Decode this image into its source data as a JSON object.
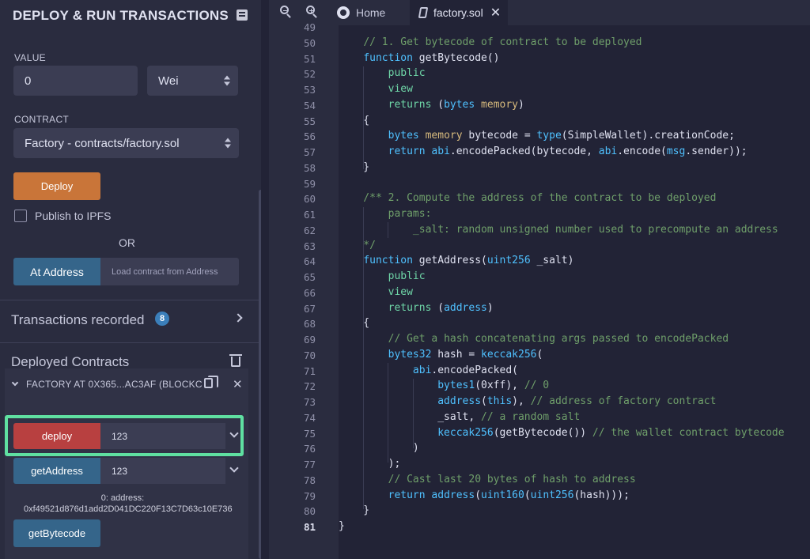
{
  "left_panel": {
    "title": "DEPLOY & RUN TRANSACTIONS",
    "value_label": "VALUE",
    "value_input": "0",
    "unit_select": "Wei",
    "contract_label": "CONTRACT",
    "contract_select": "Factory - contracts/factory.sol",
    "deploy_button": "Deploy",
    "publish_ipfs_label": "Publish to IPFS",
    "or_text": "OR",
    "at_address_button": "At Address",
    "load_contract_placeholder": "Load contract from Address",
    "transactions_recorded_label": "Transactions recorded",
    "transactions_count": "8",
    "deployed_contracts_label": "Deployed Contracts",
    "deployed_instance": {
      "header": "FACTORY AT 0X365...AC3AF (BLOCKC",
      "functions": [
        {
          "label": "deploy",
          "arg_value": "123"
        },
        {
          "label": "getAddress",
          "arg_value": "123"
        },
        {
          "label": "getBytecode"
        }
      ],
      "output": "0: address: 0xf49521d876d1add2D041DC220F13C7D63c10E736"
    }
  },
  "editor": {
    "tabs": [
      {
        "label": "Home"
      },
      {
        "label": "factory.sol",
        "active": true
      }
    ],
    "active_line": "81",
    "lines": [
      {
        "no": "49",
        "text": ""
      },
      {
        "no": "50",
        "text": "    // 1. Get bytecode of contract to be deployed"
      },
      {
        "no": "51",
        "text": "    function getBytecode()"
      },
      {
        "no": "52",
        "text": "        public"
      },
      {
        "no": "53",
        "text": "        view"
      },
      {
        "no": "54",
        "text": "        returns (bytes memory)"
      },
      {
        "no": "55",
        "text": "    {"
      },
      {
        "no": "56",
        "text": "        bytes memory bytecode = type(SimpleWallet).creationCode;"
      },
      {
        "no": "57",
        "text": "        return abi.encodePacked(bytecode, abi.encode(msg.sender));"
      },
      {
        "no": "58",
        "text": "    }"
      },
      {
        "no": "59",
        "text": ""
      },
      {
        "no": "60",
        "text": "    /** 2. Compute the address of the contract to be deployed"
      },
      {
        "no": "61",
        "text": "        params:"
      },
      {
        "no": "62",
        "text": "            _salt: random unsigned number used to precompute an address"
      },
      {
        "no": "63",
        "text": "    */"
      },
      {
        "no": "64",
        "text": "    function getAddress(uint256 _salt)"
      },
      {
        "no": "65",
        "text": "        public"
      },
      {
        "no": "66",
        "text": "        view"
      },
      {
        "no": "67",
        "text": "        returns (address)"
      },
      {
        "no": "68",
        "text": "    {"
      },
      {
        "no": "69",
        "text": "        // Get a hash concatenating args passed to encodePacked"
      },
      {
        "no": "70",
        "text": "        bytes32 hash = keccak256("
      },
      {
        "no": "71",
        "text": "            abi.encodePacked("
      },
      {
        "no": "72",
        "text": "                bytes1(0xff), // 0"
      },
      {
        "no": "73",
        "text": "                address(this), // address of factory contract"
      },
      {
        "no": "74",
        "text": "                _salt, // a random salt"
      },
      {
        "no": "75",
        "text": "                keccak256(getBytecode()) // the wallet contract bytecode"
      },
      {
        "no": "76",
        "text": "            )"
      },
      {
        "no": "77",
        "text": "        );"
      },
      {
        "no": "78",
        "text": "        // Cast last 20 bytes of hash to address"
      },
      {
        "no": "79",
        "text": "        return address(uint160(uint256(hash)));"
      },
      {
        "no": "80",
        "text": "    }"
      },
      {
        "no": "81",
        "text": "}"
      }
    ]
  }
}
